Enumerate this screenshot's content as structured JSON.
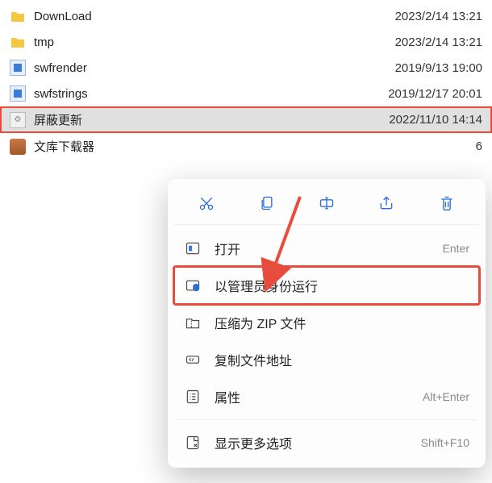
{
  "files": [
    {
      "name": "DownLoad",
      "date": "2023/2/14 13:21",
      "type": "folder"
    },
    {
      "name": "tmp",
      "date": "2023/2/14 13:21",
      "type": "folder"
    },
    {
      "name": "swfrender",
      "date": "2019/9/13 19:00",
      "type": "exe"
    },
    {
      "name": "swfstrings",
      "date": "2019/12/17 20:01",
      "type": "exe"
    },
    {
      "name": "屏蔽更新",
      "date": "2022/11/10 14:14",
      "type": "batch"
    },
    {
      "name": "文库下载器",
      "date": "6",
      "type": "app"
    }
  ],
  "contextMenu": {
    "tools": {
      "cut": "cut",
      "copy": "copy",
      "rename": "rename",
      "share": "share",
      "delete": "delete"
    },
    "items": [
      {
        "label": "打开",
        "shortcut": "Enter",
        "icon": "open"
      },
      {
        "label": "以管理员身份运行",
        "shortcut": "",
        "icon": "admin"
      },
      {
        "label": "压缩为 ZIP 文件",
        "shortcut": "",
        "icon": "zip"
      },
      {
        "label": "复制文件地址",
        "shortcut": "",
        "icon": "path"
      },
      {
        "label": "属性",
        "shortcut": "Alt+Enter",
        "icon": "props"
      },
      {
        "label": "显示更多选项",
        "shortcut": "Shift+F10",
        "icon": "more"
      }
    ]
  }
}
